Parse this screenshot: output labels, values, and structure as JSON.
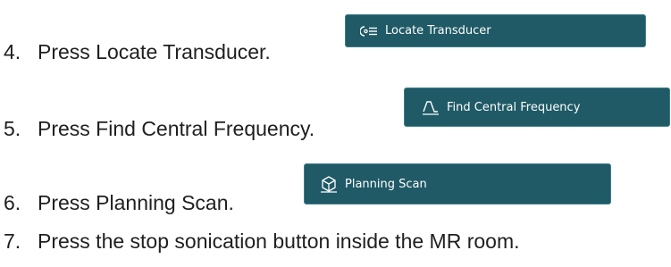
{
  "steps": [
    {
      "number": "4.",
      "text": "Press Locate Transducer."
    },
    {
      "number": "5.",
      "text": "Press Find Central Frequency."
    },
    {
      "number": "6.",
      "text": "Press Planning Scan."
    },
    {
      "number": "7.",
      "text": "Press the stop sonication button inside the MR room."
    }
  ],
  "buttons": {
    "locate_transducer": {
      "label": "Locate Transducer",
      "icon": "locate-transducer-icon"
    },
    "find_central_frequency": {
      "label": "Find Central Frequency",
      "icon": "frequency-wave-icon"
    },
    "planning_scan": {
      "label": "Planning Scan",
      "icon": "planning-scan-icon"
    }
  },
  "colors": {
    "button_background": "#1f5a66",
    "button_text": "#ffffff",
    "body_text": "#1f1f1f"
  }
}
